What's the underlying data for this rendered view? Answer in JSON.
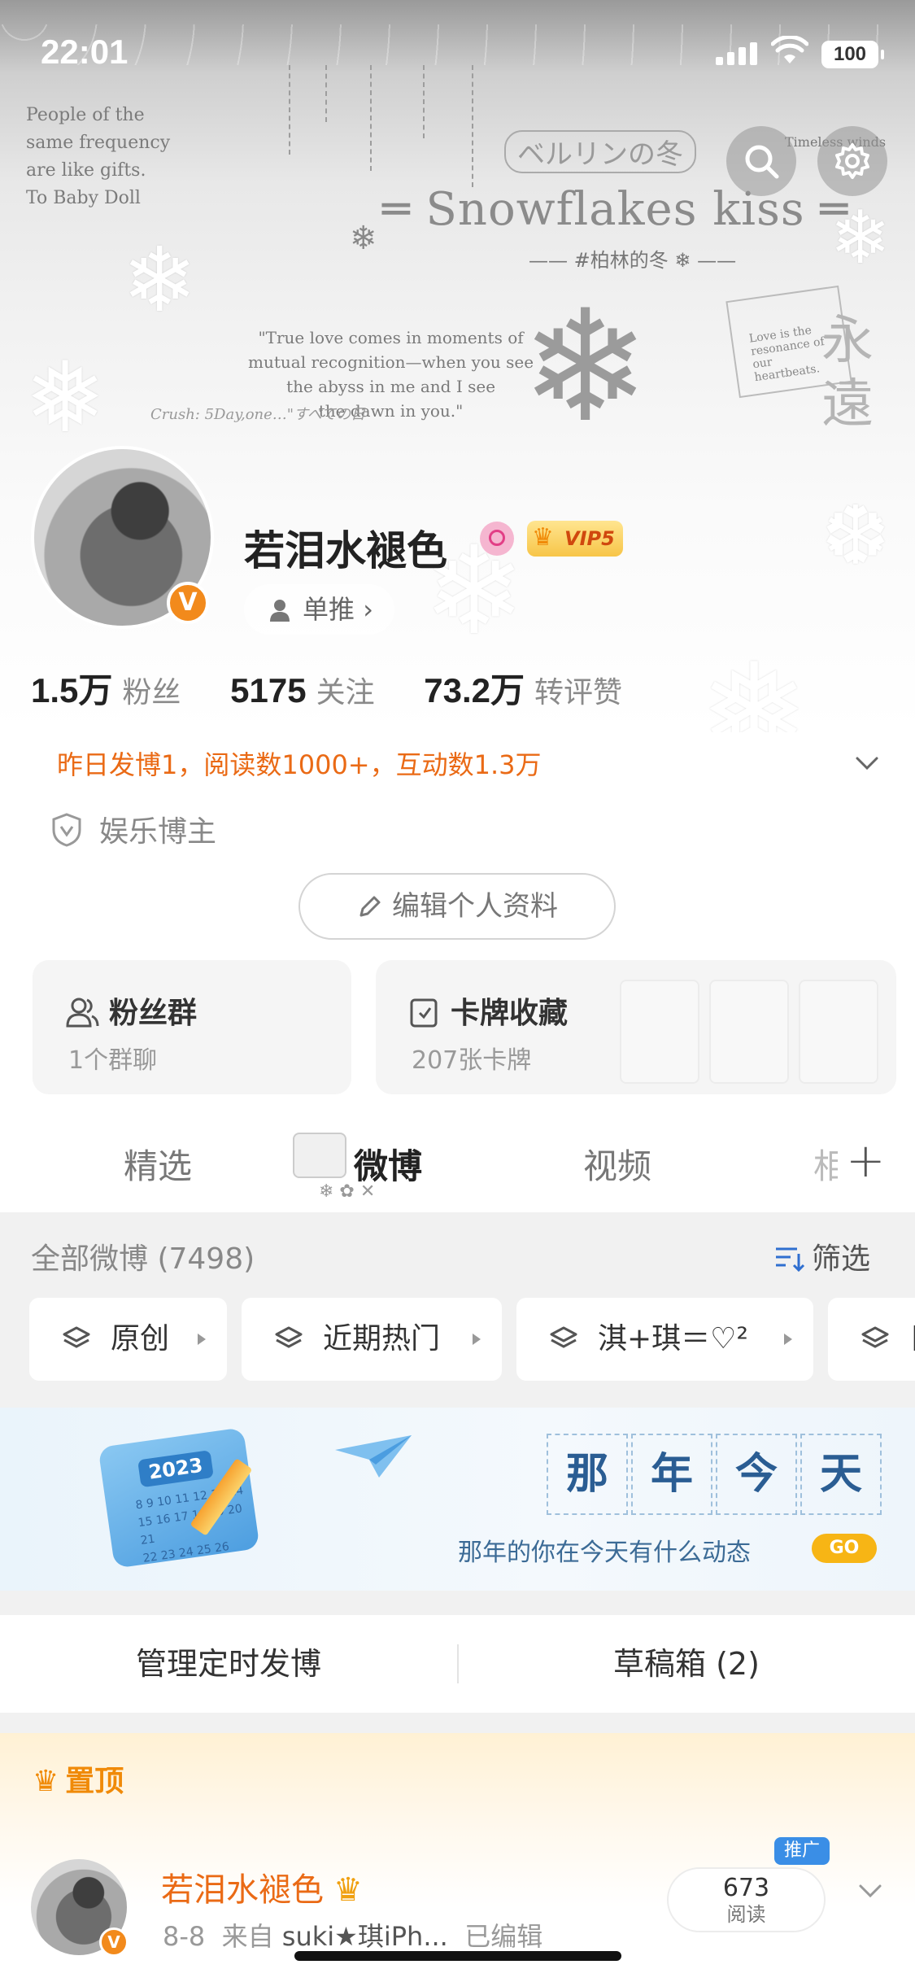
{
  "status_bar": {
    "time": "22:01",
    "battery": "100"
  },
  "banner": {
    "left_text_lines": [
      "People of the",
      "same frequency",
      "are like gifts.",
      "To Baby Doll"
    ],
    "jp_title": "ベルリンの冬",
    "title": "Snowflakes kiss",
    "subtitle": "#柏林的冬",
    "quote_lines": [
      "\"True love comes in moments of",
      "mutual recognition—when you see",
      "the abyss in me and I see",
      "the dawn in you.\""
    ],
    "crush_text": "Crush: 5Day,one…\"すべての日",
    "corner_text": "Timeless winds",
    "card_text": "Love is the resonance of our heartbeats.",
    "big_chars": "永\n遠"
  },
  "profile": {
    "username": "若泪水褪色",
    "vip_label": "VIP5",
    "verified_badge": "V",
    "tag_label": "单推",
    "stats": [
      {
        "value": "1.5万",
        "label": "粉丝"
      },
      {
        "value": "5175",
        "label": "关注"
      },
      {
        "value": "73.2万",
        "label": "转评赞"
      }
    ],
    "activity": "昨日发博1，阅读数1000+，互动数1.3万",
    "role": "娱乐博主",
    "edit_button": "编辑个人资料"
  },
  "cards": {
    "fans": {
      "title": "粉丝群",
      "sub": "1个群聊"
    },
    "collection": {
      "title": "卡牌收藏",
      "sub": "207张卡牌"
    }
  },
  "tabs": [
    "精选",
    "微博",
    "视频",
    "相"
  ],
  "feed": {
    "all_count": "全部微博 (7498)",
    "filter_label": "筛选",
    "chips": [
      "原创",
      "近期热门",
      "淇+琪＝♡²",
      "目"
    ]
  },
  "memory": {
    "year": "2023",
    "chars": [
      "那",
      "年",
      "今",
      "天"
    ],
    "sub": "那年的你在今天有什么动态",
    "go_label": "GO"
  },
  "manage": {
    "scheduled": "管理定时发博",
    "drafts": "草稿箱 (2)"
  },
  "pinned": {
    "label": "置顶",
    "author": "若泪水褪色",
    "date": "8-8",
    "from_prefix": "来自",
    "source": "suki★琪iPh...",
    "edited": "已编辑",
    "reads": "673",
    "reads_label": "阅读",
    "promo": "推广"
  }
}
